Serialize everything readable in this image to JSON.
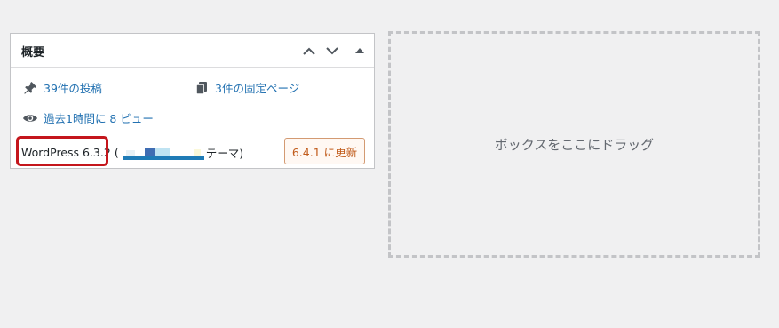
{
  "widget": {
    "title": "概要",
    "move_up_label": "Move up",
    "move_down_label": "Move down",
    "toggle_label": "Toggle panel",
    "items": {
      "posts": {
        "label": "39件の投稿",
        "icon": "pin-icon"
      },
      "pages": {
        "label": "3件の固定ページ",
        "icon": "pages-icon"
      },
      "views": {
        "label": "過去1時間に 8 ビュー",
        "icon": "eye-icon"
      }
    },
    "version": {
      "wp_version": "WordPress 6.3.2",
      "theme_open": "(",
      "theme_suffix": "テーマ)"
    },
    "update_button": "6.4.1 に更新"
  },
  "drop_zone": {
    "label": "ボックスをここにドラッグ"
  },
  "colors": {
    "background": "#f0f0f1",
    "link": "#2271b1",
    "highlight": "#c4161c",
    "update_text": "#c15c1c",
    "update_border": "#d39a72"
  }
}
